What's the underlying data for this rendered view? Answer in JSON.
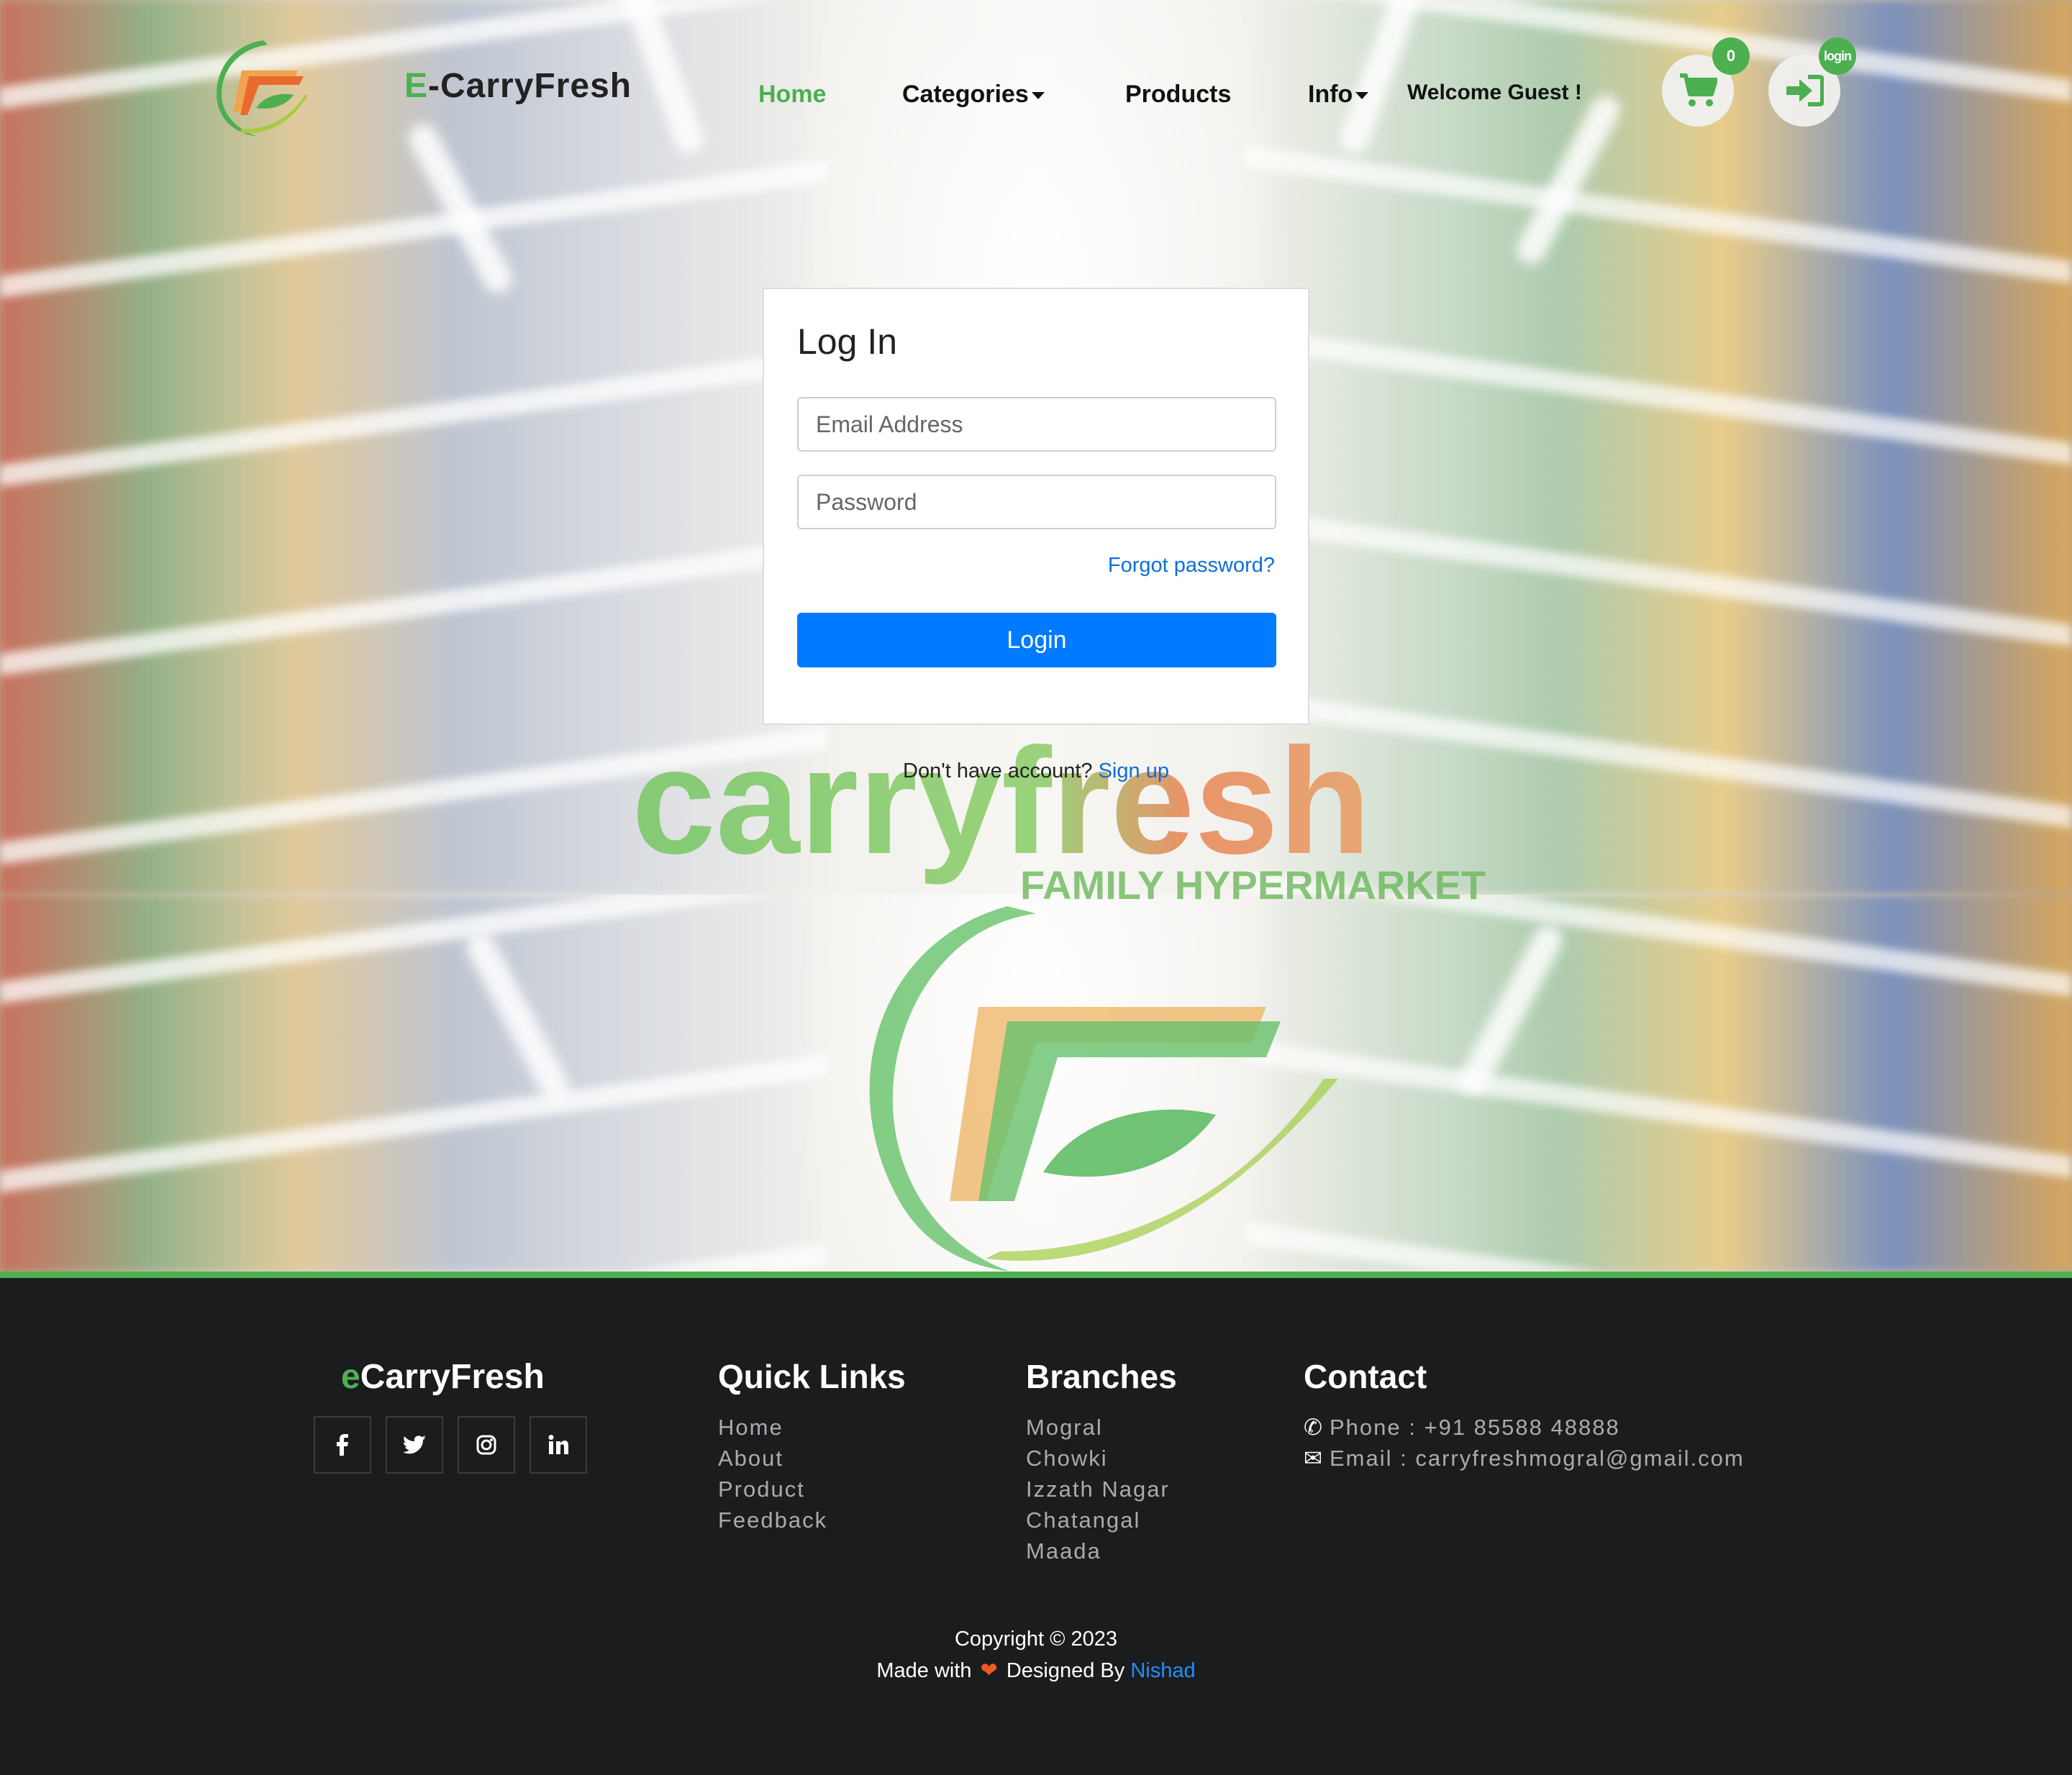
{
  "header": {
    "brand_prefix": "E",
    "brand_rest": "-CarryFresh",
    "nav": [
      {
        "label": "Home",
        "active": true
      },
      {
        "label": "Categories",
        "dropdown": true
      },
      {
        "label": "Products"
      },
      {
        "label": "Info",
        "dropdown": true
      }
    ],
    "welcome": "Welcome Guest !",
    "cart_count": "0",
    "login_badge": "login",
    "icons": {
      "cart": "cart-icon",
      "login": "sign-in-icon"
    }
  },
  "login": {
    "title": "Log In",
    "email_placeholder": "Email Address",
    "password_placeholder": "Password",
    "forgot": "Forgot password?",
    "button": "Login",
    "no_account": "Don't have account?",
    "signup": "Sign up"
  },
  "watermark": {
    "word": "carryfresh",
    "tagline": "FAMILY HYPERMARKET"
  },
  "footer": {
    "brand_prefix": "e",
    "brand_rest": "CarryFresh",
    "social": [
      "f",
      "t",
      "ig",
      "in"
    ],
    "quick_links_title": "Quick Links",
    "quick_links": [
      "Home",
      "About",
      "Product",
      "Feedback"
    ],
    "branches_title": "Branches",
    "branches": [
      "Mogral",
      "Chowki",
      "Izzath Nagar",
      "Chatangal",
      "Maada"
    ],
    "contact_title": "Contact",
    "phone": "Phone : +91 85588 48888",
    "email": "Email : carryfreshmogral@gmail.com",
    "copyright": "Copyright © 2023",
    "made_with": "Made with",
    "designed_by": "Designed By",
    "designer": "Nishad"
  },
  "colors": {
    "accent": "#4caf50",
    "primary": "#007bff",
    "link": "#0a6fd8",
    "footer_bg": "#1b1c1e"
  }
}
